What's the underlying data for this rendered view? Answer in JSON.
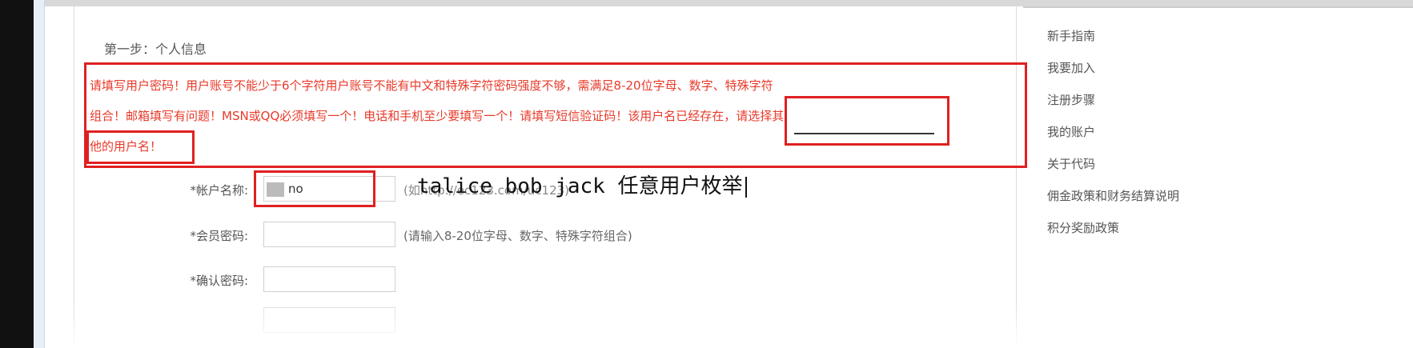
{
  "step": {
    "title": "第一步：个人信息"
  },
  "error": {
    "line1": "请填写用户密码！用户账号不能少于6个字符用户账号不能有中文和特殊字符密码强度不够，需满足8-20位字母、数字、特殊字符",
    "line2": "组合！邮箱填写有问题！MSN或QQ必须填写一个！电话和手机至少要填写一个！请填写短信验证码！该用户名已经存在，请选择其",
    "line3": "他的用户名！",
    "highlight_exists": "该用户名已经存在，"
  },
  "form": {
    "account_label": "*帐户名称:",
    "account_value": "no",
    "account_hint": "(如http://ec123.com/uc123)",
    "password_label": "*会员密码:",
    "password_hint": "(请输入8-20位字母、数字、特殊字符组合)",
    "confirm_label": "*确认密码:"
  },
  "annotation": {
    "text": "talice bob jack 任意用户枚举"
  },
  "side_nav": {
    "items": [
      "新手指南",
      "我要加入",
      "注册步骤",
      "我的账户",
      "关于代码",
      "佣金政策和财务结算说明",
      "积分奖励政策"
    ]
  },
  "colors": {
    "error_red": "#e83a2a",
    "box_red": "#e02020"
  }
}
